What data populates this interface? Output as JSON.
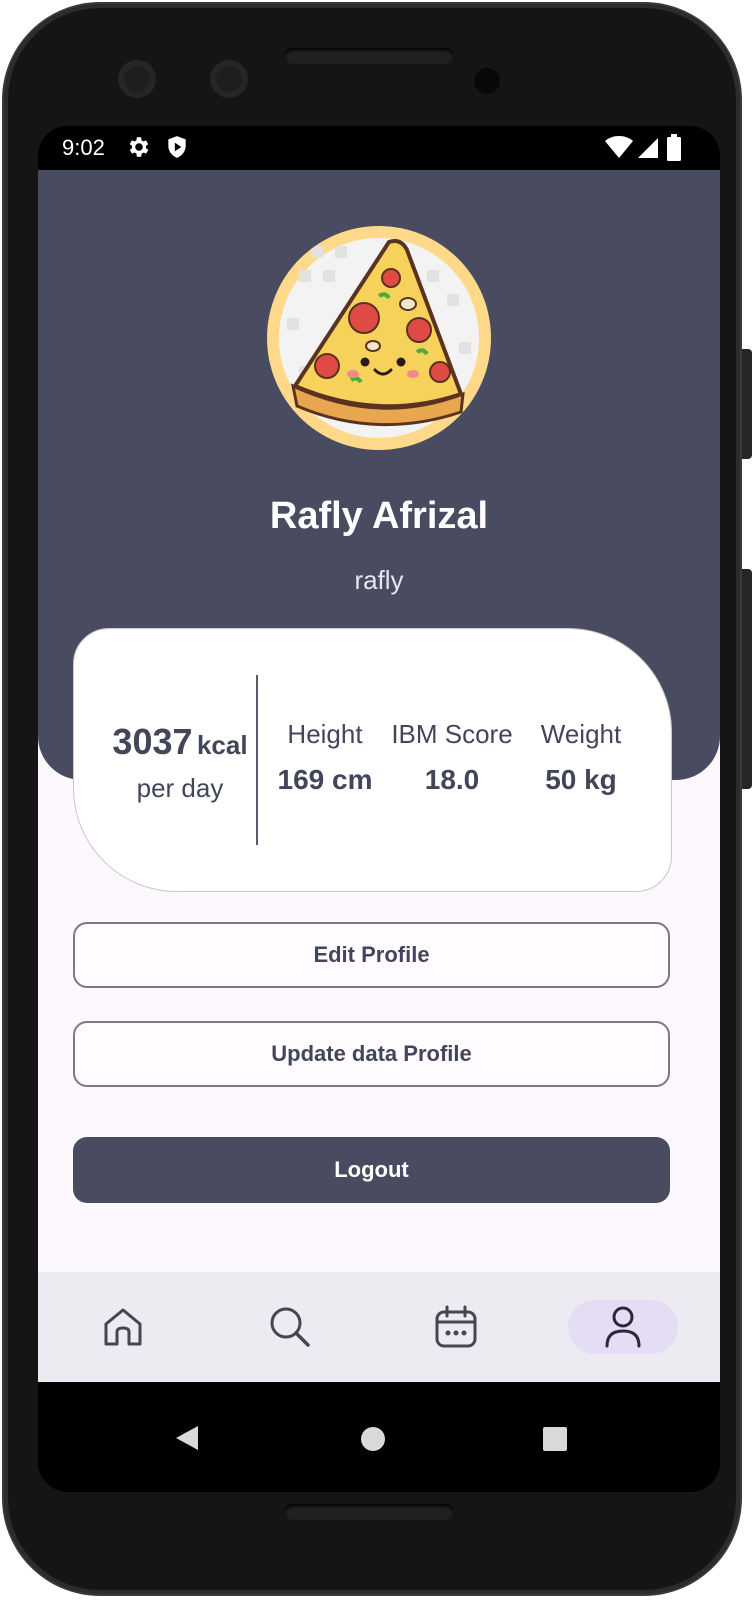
{
  "status_bar": {
    "time": "9:02",
    "left_icons": [
      "gear-icon",
      "shield-play-icon"
    ],
    "right_icons": [
      "wifi-icon",
      "signal-icon",
      "battery-icon"
    ]
  },
  "profile": {
    "avatar": "pizza-slice-avatar",
    "name": "Rafly Afrizal",
    "username": "rafly"
  },
  "stats": {
    "calories_value": "3037",
    "calories_unit": "kcal",
    "calories_sub": "per day",
    "items": [
      {
        "label": "Height",
        "value": "169 cm"
      },
      {
        "label": "IBM Score",
        "value": "18.0"
      },
      {
        "label": "Weight",
        "value": "50 kg"
      }
    ]
  },
  "buttons": {
    "edit_profile": "Edit Profile",
    "update_data_profile": "Update data Profile",
    "logout": "Logout"
  },
  "bottom_nav": {
    "items": [
      "home-icon",
      "search-icon",
      "calendar-icon",
      "profile-icon"
    ],
    "active": "profile-icon"
  },
  "colors": {
    "header": "#494c60",
    "accent_pill": "#e5dcf5",
    "background": "#fdf8fd",
    "text": "#43465a"
  }
}
